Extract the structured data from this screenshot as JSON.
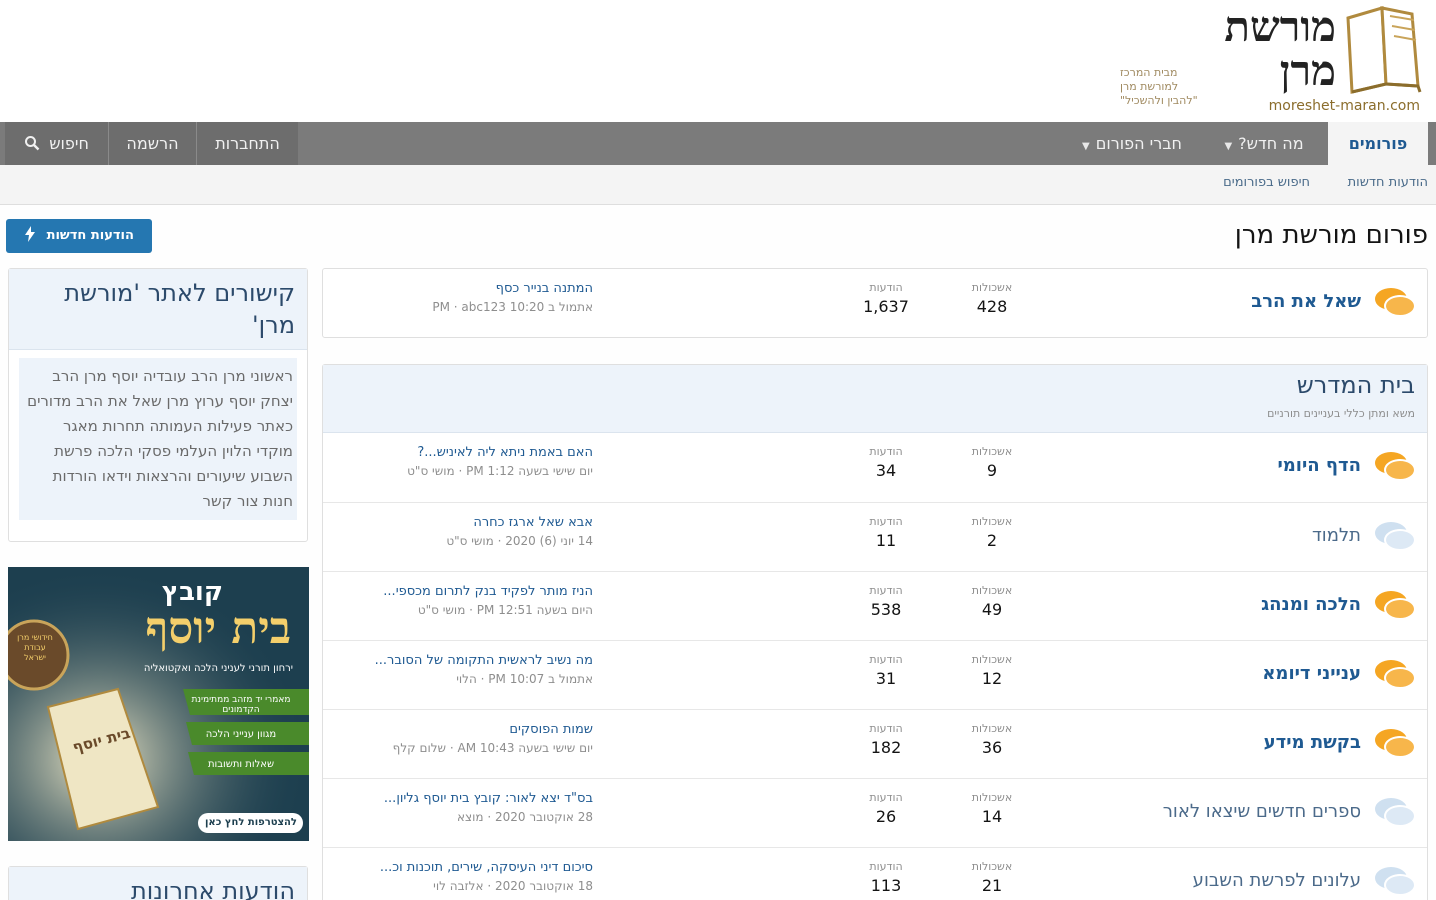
{
  "logo": {
    "line1": "מורשת",
    "line2": "מרן",
    "tagline1": "מבית המרכז",
    "tagline2": "למורשת מרן",
    "tagline3": "\"להבין ולהשכיל\"",
    "url": "moreshet-maran.com"
  },
  "nav": {
    "tabs": [
      {
        "label": "פורומים"
      },
      {
        "label": "מה חדש?"
      },
      {
        "label": "חברי הפורום"
      }
    ],
    "login": "התחברות",
    "register": "הרשמה",
    "search": "חיפוש"
  },
  "subnav": {
    "new_posts": "הודעות חדשות",
    "search_forums": "חיפוש בפורומים"
  },
  "page": {
    "title": "פורום מורשת מרן",
    "new_post_button": "הודעות חדשות"
  },
  "labels": {
    "threads": "אשכולות",
    "messages": "הודעות"
  },
  "top_forum": {
    "name": "שאל את הרב",
    "threads": "428",
    "messages": "1,637",
    "last_title": "המתנה בנייר כסף",
    "last_meta": "אתמול ב 10:20 PM · abc123"
  },
  "category": {
    "title": "בית המדרש",
    "description": "משא ומתן כללי בעניינים תורניים",
    "forums": [
      {
        "name": "הדף היומי",
        "read": false,
        "threads": "9",
        "messages": "34",
        "last_title": "האם באמת ניתא ליה לאיניש...?",
        "last_meta": "יום שישי בשעה 1:12 PM · מושי ס\"ט"
      },
      {
        "name": "תלמוד",
        "read": true,
        "threads": "2",
        "messages": "11",
        "last_title": "אבא שאל ארגז כחרה",
        "last_meta": "14 יוני (6) 2020 · מושי ס\"ט"
      },
      {
        "name": "הלכה ומנהג",
        "read": false,
        "threads": "49",
        "messages": "538",
        "last_title": "הניז מותר לפקיד בנק לתרום מכספי...",
        "last_meta": "היום בשעה 12:51 PM · מושי ס\"ט"
      },
      {
        "name": "ענייני דיומא",
        "read": false,
        "threads": "12",
        "messages": "31",
        "last_title": "מה נשיב לראשית התקומה של הסובר...",
        "last_meta": "אתמול ב 10:07 PM · הלוי"
      },
      {
        "name": "בקשת מידע",
        "read": false,
        "threads": "36",
        "messages": "182",
        "last_title": "שמות הפוסקים",
        "last_meta": "יום שישי בשעה 10:43 AM · שלום קלף"
      },
      {
        "name": "ספרים חדשים שיצאו לאור",
        "read": true,
        "threads": "14",
        "messages": "26",
        "last_title": "בס\"ד יצא לאור: קובץ בית יוסף גליון...",
        "last_meta": "28 אוקטובר 2020 · מוצא"
      },
      {
        "name": "עלונים לפרשת השבוע",
        "read": true,
        "threads": "21",
        "messages": "113",
        "last_title": "סיכום דיני העיסקה, שירים, תוכנות וכ...",
        "last_meta": "18 אוקטובר 2020 · אלזבה לוי"
      }
    ]
  },
  "sidebar": {
    "links_title": "קישורים לאתר 'מורשת מרן'",
    "links_body": "ראשוני מרן הרב עובדיה יוסף מרן הרב יצחק יוסף ערוץ מרן שאל את הרב מדורים כאתר פעילות העמותה תחרות מאגר מוקדי הלוין העלמי פסקי הלכה פרשת השבוע שיעורים והרצאות וידאו הורדות חנות צור קשר",
    "latest_title": "הודעות אחרונות"
  },
  "ad": {
    "kicker": "קובץ",
    "title": "בית יוסף",
    "subtitle": "ירחון תורני לעניני הלכה ואקטואליה",
    "bullets": [
      "מאמרי יד מזהב ממתימינת הקדמונים",
      "מגוון ענייני הלכה",
      "שאלות ותשובות"
    ],
    "cta": "להצטרפות לחץ כאן",
    "book_label": "בית יוסף",
    "seal": "חידושי מרן עבודת ישראל"
  },
  "colors": {
    "accent": "#2577b1",
    "nav": "#7b7b7b",
    "link": "#1f5a92",
    "bubble_unread": "#f5a623",
    "bubble_read": "#cfe0f0"
  }
}
